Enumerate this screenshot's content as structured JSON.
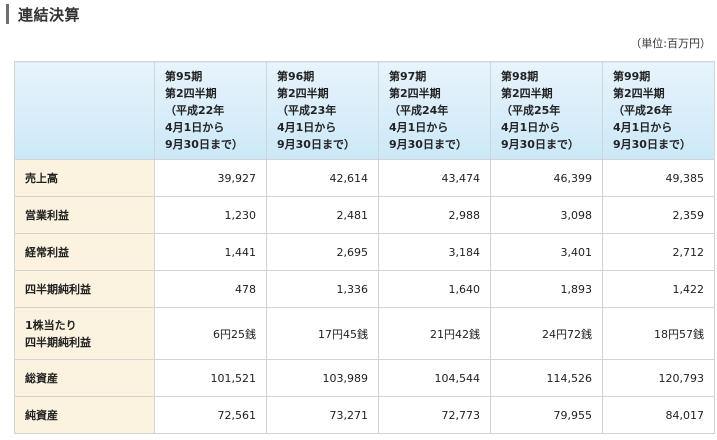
{
  "title": "連結決算",
  "unit_note": "（単位:百万円）",
  "columns": [
    "第95期\n第2四半期\n（平成22年\n4月1日から\n9月30日まで）",
    "第96期\n第2四半期\n（平成23年\n4月1日から\n9月30日まで）",
    "第97期\n第2四半期\n（平成24年\n4月1日から\n9月30日まで）",
    "第98期\n第2四半期\n（平成25年\n4月1日から\n9月30日まで）",
    "第99期\n第2四半期\n（平成26年\n4月1日から\n9月30日まで）"
  ],
  "rows": [
    {
      "label": "売上高",
      "values": [
        "39,927",
        "42,614",
        "43,474",
        "46,399",
        "49,385"
      ]
    },
    {
      "label": "営業利益",
      "values": [
        "1,230",
        "2,481",
        "2,988",
        "3,098",
        "2,359"
      ]
    },
    {
      "label": "経常利益",
      "values": [
        "1,441",
        "2,695",
        "3,184",
        "3,401",
        "2,712"
      ]
    },
    {
      "label": "四半期純利益",
      "values": [
        "478",
        "1,336",
        "1,640",
        "1,893",
        "1,422"
      ]
    },
    {
      "label": "1株当たり\n四半期純利益",
      "values": [
        "6円25銭",
        "17円45銭",
        "21円42銭",
        "24円72銭",
        "18円57銭"
      ]
    },
    {
      "label": "総資産",
      "values": [
        "101,521",
        "103,989",
        "104,544",
        "114,526",
        "120,793"
      ]
    },
    {
      "label": "純資産",
      "values": [
        "72,561",
        "73,271",
        "72,773",
        "79,955",
        "84,017"
      ]
    }
  ]
}
